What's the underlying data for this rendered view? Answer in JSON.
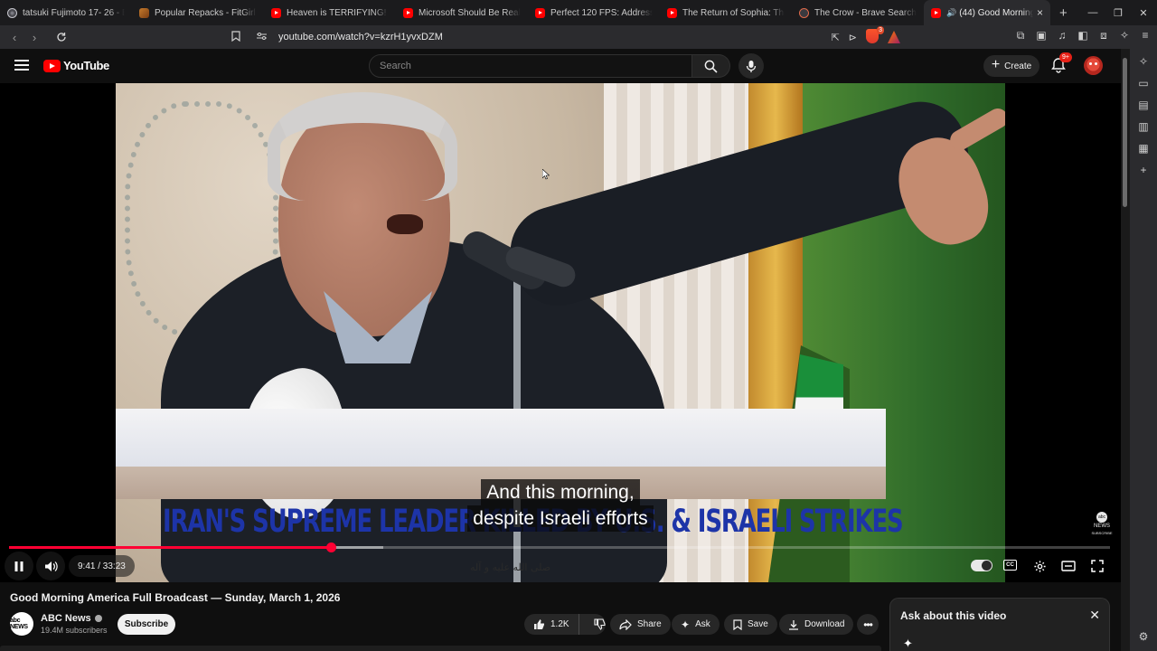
{
  "browser": {
    "tabs": [
      {
        "label": "tatsuki Fujimoto 17- 26 - Br",
        "icon": "brave-icon"
      },
      {
        "label": "Popular Repacks - FitGirl Re",
        "icon": "fitgirl-icon"
      },
      {
        "label": "Heaven is TERRIFYING! - Yo",
        "icon": "youtube-icon"
      },
      {
        "label": "Microsoft Should Be Really",
        "icon": "youtube-icon"
      },
      {
        "label": "Perfect 120 FPS: Addressing",
        "icon": "youtube-icon"
      },
      {
        "label": "The Return of Sophia: The F",
        "icon": "youtube-icon"
      },
      {
        "label": "The Crow - Brave Search",
        "icon": "brave-search-icon"
      },
      {
        "label": "(44) Good Morning A",
        "icon": "youtube-icon",
        "active": true
      }
    ],
    "url": "youtube.com/watch?v=kzrH1yvxDZM",
    "shield_count": "3"
  },
  "youtube": {
    "logo_text": "YouTube",
    "search_placeholder": "Search",
    "create_label": "Create",
    "notif_count": "9+"
  },
  "video": {
    "banner": "IRAN'S SUPREME LEADER KILLED BY U.S. & ISRAELI STRIKES",
    "captions": [
      "And this morning,",
      "despite Israeli efforts"
    ],
    "watermark_logo": "abc",
    "watermark_text": "NEWS",
    "watermark_sub": "SUBSCRIBE",
    "arabic": "صلی الله علیه و آله",
    "time_display": "9:41 / 33:23",
    "progress_fraction": 0.292,
    "buffer_fraction": 0.34,
    "accent": "#ff0033"
  },
  "info": {
    "title": "Good Morning America Full Broadcast — Sunday, March 1, 2026",
    "channel": "ABC News",
    "channel_avatar": "abc NEWS",
    "subscribers": "19.4M subscribers",
    "subscribe_label": "Subscribe",
    "likes": "1.2K",
    "share_label": "Share",
    "ask_label": "Ask",
    "save_label": "Save",
    "download_label": "Download"
  },
  "ask_panel": {
    "title": "Ask about this video"
  }
}
